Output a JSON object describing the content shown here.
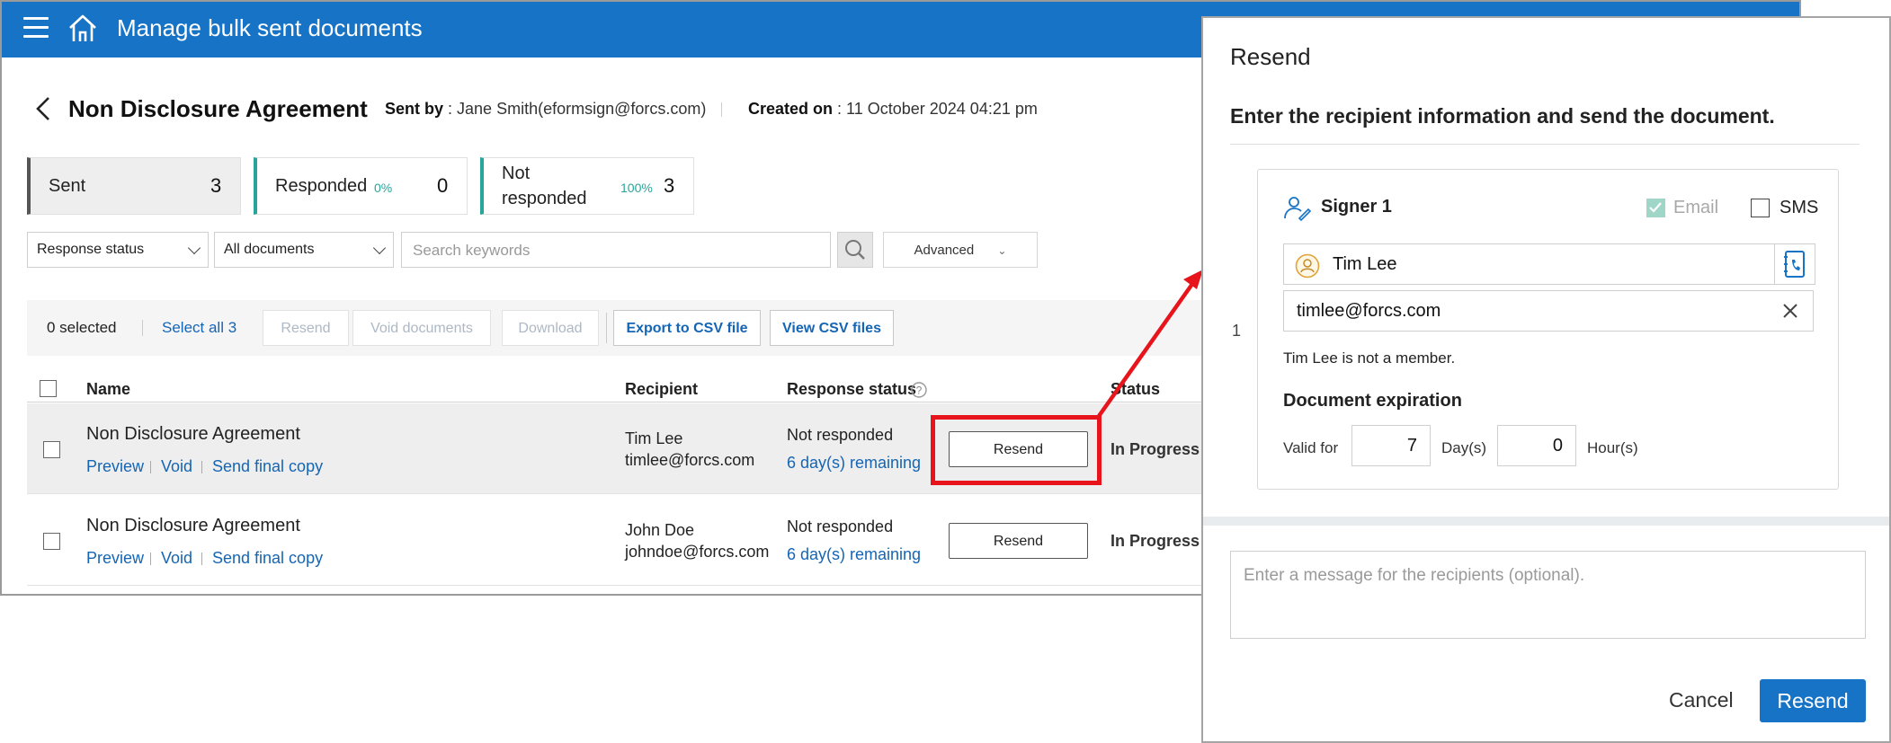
{
  "app": {
    "title": "Manage bulk sent documents"
  },
  "document": {
    "title": "Non Disclosure Agreement",
    "sent_by_label": "Sent by",
    "sent_by_value": ": Jane Smith(eformsign@forcs.com)",
    "created_label": "Created on",
    "created_value": ": 11 October 2024 04:21 pm"
  },
  "stats": [
    {
      "label": "Sent",
      "count": "3"
    },
    {
      "label": "Responded",
      "percent": "0%",
      "count": "0"
    },
    {
      "label_line1": "Not",
      "label_line2": "responded",
      "percent": "100%",
      "count": "3"
    }
  ],
  "filters": {
    "response_status": "Response status",
    "documents": "All documents",
    "search_placeholder": "Search keywords",
    "advanced": "Advanced"
  },
  "toolbar": {
    "selected": "0 selected",
    "select_all": "Select all 3",
    "resend": "Resend",
    "void": "Void documents",
    "download": "Download",
    "export_csv": "Export to CSV file",
    "view_csv": "View CSV files"
  },
  "table": {
    "headers": {
      "name": "Name",
      "recipient": "Recipient",
      "response_status": "Response status",
      "status": "Status"
    },
    "rows": [
      {
        "name": "Non Disclosure Agreement",
        "preview": "Preview",
        "void": "Void",
        "send_final": "Send final copy",
        "recipient_name": "Tim Lee",
        "recipient_email": "timlee@forcs.com",
        "response": "Not responded",
        "remaining": "6 day(s) remaining",
        "action": "Resend",
        "status": "In Progress"
      },
      {
        "name": "Non Disclosure Agreement",
        "preview": "Preview",
        "void": "Void",
        "send_final": "Send final copy",
        "recipient_name": "John Doe",
        "recipient_email": "johndoe@forcs.com",
        "response": "Not responded",
        "remaining": "6 day(s) remaining",
        "action": "Resend",
        "status": "In Progress"
      }
    ]
  },
  "dialog": {
    "title": "Resend",
    "subtitle": "Enter the recipient information and send the document.",
    "index": "1",
    "signer_label": "Signer 1",
    "email_label": "Email",
    "sms_label": "SMS",
    "name_value": "Tim Lee",
    "email_value": "timlee@forcs.com",
    "member_note": "Tim Lee is  not a member.",
    "expiration_title": "Document expiration",
    "valid_for": "Valid for",
    "days_value": "7",
    "days_label": "Day(s)",
    "hours_value": "0",
    "hours_label": "Hour(s)",
    "message_placeholder": "Enter a message for the recipients (optional).",
    "cancel": "Cancel",
    "resend": "Resend"
  },
  "colors": {
    "brand": "#1673c6",
    "accent_teal": "#26a69a",
    "highlight_red": "#e8141c",
    "link": "#1565b5"
  }
}
